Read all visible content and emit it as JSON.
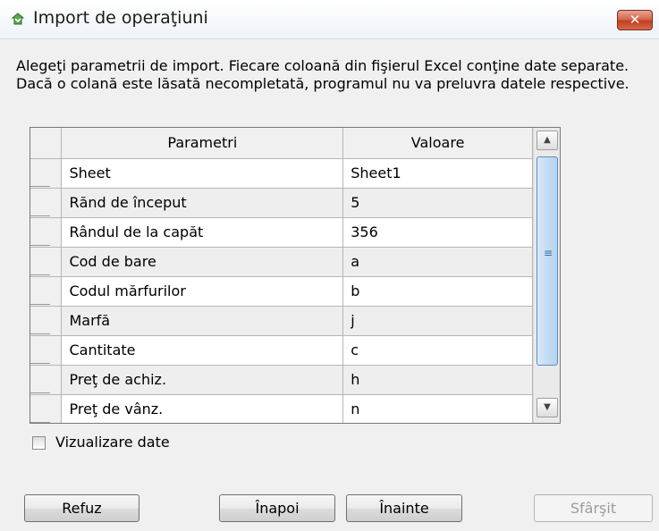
{
  "window": {
    "title": "Import de operaţiuni",
    "close_label": "✕"
  },
  "description": "Alegeţi parametrii de import. Fiecare coloană din fişierul Excel conţine date separate. Dacă o colană este lăsată necompletată, programul nu va preluvra datele respective.",
  "grid": {
    "columns": [
      "Parametri",
      "Valoare"
    ],
    "rows": [
      {
        "param": "Sheet",
        "value": "Sheet1"
      },
      {
        "param": "Rănd de început",
        "value": "5"
      },
      {
        "param": "Rândul de la capăt",
        "value": "356"
      },
      {
        "param": "Cod de bare",
        "value": "a"
      },
      {
        "param": "Codul mărfurilor",
        "value": "b"
      },
      {
        "param": "Marfă",
        "value": "j"
      },
      {
        "param": "Cantitate",
        "value": "c"
      },
      {
        "param": "Preţ de achiz.",
        "value": "h"
      },
      {
        "param": "Preţ de vânz.",
        "value": "n"
      }
    ]
  },
  "options": {
    "preview_label": "Vizualizare date",
    "preview_checked": false
  },
  "buttons": {
    "cancel": "Refuz",
    "back": "Înapoi",
    "next": "Înainte",
    "finish": "Sfârşit"
  }
}
